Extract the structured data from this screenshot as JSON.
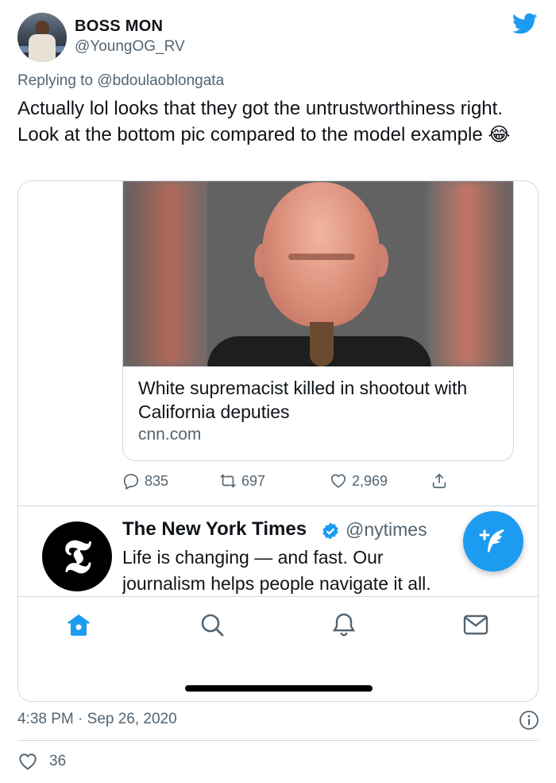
{
  "author": {
    "display_name": "BOSS MON",
    "handle": "@YoungOG_RV"
  },
  "reply": {
    "prefix": "Replying to ",
    "mention": "@bdoulaoblongata"
  },
  "tweet": {
    "text": "Actually lol looks that they got the untrustworthiness right. Look at the bottom pic compared to the model example 😂"
  },
  "quoted": {
    "card": {
      "title": "White supremacist killed in shootout with California deputies",
      "domain": "cnn.com"
    },
    "actions": {
      "replies": "835",
      "retweets": "697",
      "likes": "2,969"
    },
    "next_tweet": {
      "avatar_glyph": "𝕿",
      "name": "The New York Times",
      "handle": "@nytimes",
      "text": "Life is changing — and fast. Our journalism helps people navigate it all."
    }
  },
  "meta": {
    "timestamp": "4:38 PM · Sep 26, 2020",
    "like_count": "36"
  },
  "colors": {
    "accent": "#1d9bf0",
    "text_secondary": "#536471",
    "border": "#cfd9de"
  },
  "icons": {
    "brand": "twitter-bird-icon",
    "reply": "reply-icon",
    "retweet": "retweet-icon",
    "like": "heart-icon",
    "share": "share-icon",
    "verified": "verified-badge-icon",
    "compose": "compose-feather-icon",
    "nav": [
      "home-icon",
      "search-icon",
      "notifications-bell-icon",
      "messages-envelope-icon"
    ],
    "info": "info-icon"
  }
}
